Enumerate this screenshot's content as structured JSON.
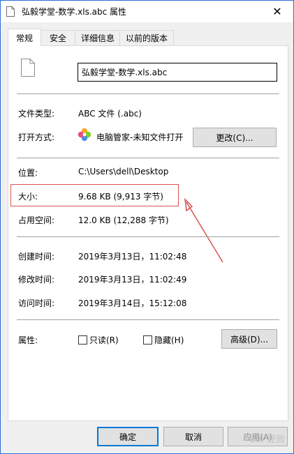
{
  "window": {
    "title": "弘毅学堂-数学.xls.abc 属性",
    "close_glyph": "✕"
  },
  "tabs": [
    {
      "label": "常规",
      "active": true
    },
    {
      "label": "安全",
      "active": false
    },
    {
      "label": "详细信息",
      "active": false
    },
    {
      "label": "以前的版本",
      "active": false
    }
  ],
  "general": {
    "filename": "弘毅学堂-数学.xls.abc",
    "file_type_label": "文件类型:",
    "file_type_value": "ABC 文件 (.abc)",
    "open_with_label": "打开方式:",
    "open_with_value": "电脑管家-未知文件打开",
    "change_button": "更改(C)...",
    "location_label": "位置:",
    "location_value": "C:\\Users\\dell\\Desktop",
    "size_label": "大小:",
    "size_value": "9.68 KB (9,913 字节)",
    "size_on_disk_label": "占用空间:",
    "size_on_disk_value": "12.0 KB (12,288 字节)",
    "created_label": "创建时间:",
    "created_value": "2019年3月13日，11:02:48",
    "modified_label": "修改时间:",
    "modified_value": "2019年3月13日，11:02:49",
    "accessed_label": "访问时间:",
    "accessed_value": "2019年3月14日，15:12:08",
    "attributes_label": "属性:",
    "readonly_label": "只读(R)",
    "readonly_checked": false,
    "hidden_label": "隐藏(H)",
    "hidden_checked": false,
    "advanced_button": "高级(D)..."
  },
  "footer": {
    "ok_button": "确定",
    "cancel_button": "取消",
    "apply_button": "应用(A)"
  },
  "watermark": "Bai 经验",
  "colors": {
    "accent": "#0078d7",
    "annotation": "#d9534f"
  }
}
